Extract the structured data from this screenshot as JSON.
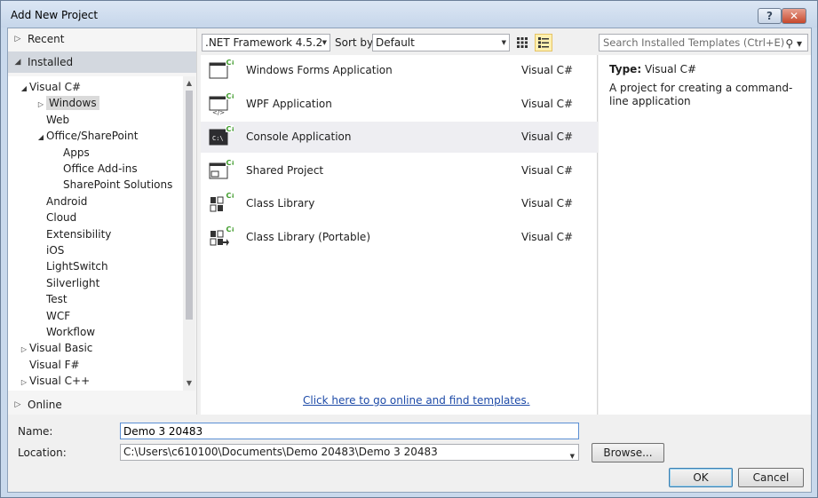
{
  "window": {
    "title": "Add New Project",
    "help": "?",
    "close": "✕"
  },
  "nav": {
    "recent": "Recent",
    "installed": "Installed",
    "online": "Online",
    "tree": [
      {
        "label": "Visual C#",
        "level": 0,
        "arrow": "◢"
      },
      {
        "label": "Windows",
        "level": 1,
        "arrow": "▷",
        "selected": true
      },
      {
        "label": "Web",
        "level": 1,
        "arrow": ""
      },
      {
        "label": "Office/SharePoint",
        "level": 1,
        "arrow": "◢"
      },
      {
        "label": "Apps",
        "level": 2,
        "arrow": ""
      },
      {
        "label": "Office Add-ins",
        "level": 2,
        "arrow": ""
      },
      {
        "label": "SharePoint Solutions",
        "level": 2,
        "arrow": ""
      },
      {
        "label": "Android",
        "level": 1,
        "arrow": ""
      },
      {
        "label": "Cloud",
        "level": 1,
        "arrow": ""
      },
      {
        "label": "Extensibility",
        "level": 1,
        "arrow": ""
      },
      {
        "label": "iOS",
        "level": 1,
        "arrow": ""
      },
      {
        "label": "LightSwitch",
        "level": 1,
        "arrow": ""
      },
      {
        "label": "Silverlight",
        "level": 1,
        "arrow": ""
      },
      {
        "label": "Test",
        "level": 1,
        "arrow": ""
      },
      {
        "label": "WCF",
        "level": 1,
        "arrow": ""
      },
      {
        "label": "Workflow",
        "level": 1,
        "arrow": ""
      },
      {
        "label": "Visual Basic",
        "level": 0,
        "arrow": "▷"
      },
      {
        "label": "Visual F#",
        "level": 0,
        "arrow": ""
      },
      {
        "label": "Visual C++",
        "level": 0,
        "arrow": "▷"
      }
    ]
  },
  "toolbar": {
    "framework": ".NET Framework 4.5.2",
    "sort_label": "Sort by:",
    "sort_value": "Default",
    "search_placeholder": "Search Installed Templates (Ctrl+E)"
  },
  "templates": [
    {
      "name": "Windows Forms Application",
      "lang": "Visual C#",
      "icon": "windows-forms-icon"
    },
    {
      "name": "WPF Application",
      "lang": "Visual C#",
      "icon": "wpf-icon"
    },
    {
      "name": "Console Application",
      "lang": "Visual C#",
      "icon": "console-icon",
      "selected": true
    },
    {
      "name": "Shared Project",
      "lang": "Visual C#",
      "icon": "shared-project-icon"
    },
    {
      "name": "Class Library",
      "lang": "Visual C#",
      "icon": "class-library-icon"
    },
    {
      "name": "Class Library (Portable)",
      "lang": "Visual C#",
      "icon": "portable-library-icon"
    }
  ],
  "online_link": "Click here to go online and find templates.",
  "details": {
    "type_label": "Type:",
    "type_value": "Visual C#",
    "description": "A project for creating a command-line application"
  },
  "form": {
    "name_label": "Name:",
    "name_value": "Demo 3 20483",
    "location_label": "Location:",
    "location_value": "C:\\Users\\c610100\\Documents\\Demo 20483\\Demo 3 20483",
    "browse": "Browse...",
    "ok": "OK",
    "cancel": "Cancel"
  }
}
